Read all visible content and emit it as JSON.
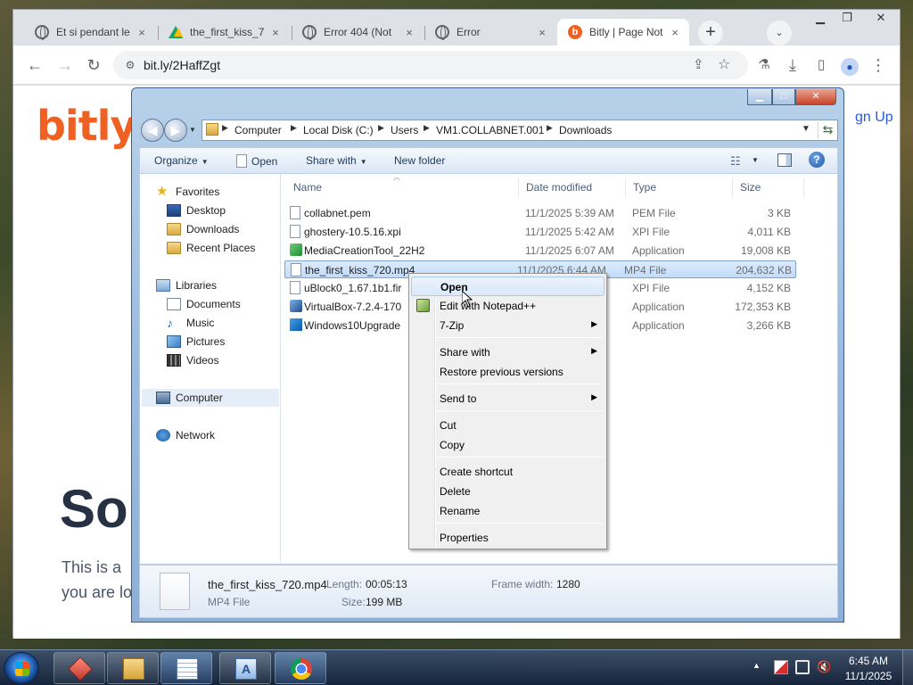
{
  "browser": {
    "tabs": [
      {
        "title": "Et si pendant le",
        "icon": "globe-icon"
      },
      {
        "title": "the_first_kiss_7",
        "icon": "google-drive-icon"
      },
      {
        "title": "Error 404 (Not",
        "icon": "globe-icon"
      },
      {
        "title": "Error",
        "icon": "globe-icon"
      },
      {
        "title": "Bitly | Page Not",
        "icon": "bitly-icon"
      }
    ],
    "active_tab": 4,
    "url": "bit.ly/2HaffZgt",
    "bitly_fav": "b",
    "new_tab": "+",
    "tab_search": "⌄",
    "close_glyph": "×"
  },
  "bitly_page": {
    "logo": "bitly",
    "signup": "gn Up",
    "title_fragment": "Sor",
    "para_line1": "This is a ",
    "para_line2": "you are lo"
  },
  "explorer": {
    "breadcrumb": [
      "Computer",
      "Local Disk (C:)",
      "Users",
      "VM1.COLLABNET.001",
      "Downloads"
    ],
    "toolbar": {
      "organize": "Organize",
      "open": "Open",
      "share_with": "Share with",
      "new_folder": "New folder"
    },
    "nav": {
      "favorites": "Favorites",
      "favorites_items": [
        "Desktop",
        "Downloads",
        "Recent Places"
      ],
      "libraries": "Libraries",
      "libraries_items": [
        "Documents",
        "Music",
        "Pictures",
        "Videos"
      ],
      "computer": "Computer",
      "network": "Network"
    },
    "columns": {
      "name": "Name",
      "date": "Date modified",
      "type": "Type",
      "size": "Size"
    },
    "files": [
      {
        "name": "collabnet.pem",
        "date": "11/1/2025 5:39 AM",
        "type": "PEM File",
        "size": "3 KB",
        "icon": "blank"
      },
      {
        "name": "ghostery-10.5.16.xpi",
        "date": "11/1/2025 5:42 AM",
        "type": "XPI File",
        "size": "4,011 KB",
        "icon": "blank"
      },
      {
        "name": "MediaCreationTool_22H2",
        "date": "11/1/2025 6:07 AM",
        "type": "Application",
        "size": "19,008 KB",
        "icon": "mct"
      },
      {
        "name": "the_first_kiss_720.mp4",
        "date": "11/1/2025 6:44 AM",
        "type": "MP4 File",
        "size": "204,632 KB",
        "icon": "blank"
      },
      {
        "name": "uBlock0_1.67.1b1.fir",
        "date": "",
        "type": "XPI File",
        "size": "4,152 KB",
        "icon": "blank"
      },
      {
        "name": "VirtualBox-7.2.4-170",
        "date": "",
        "type": "Application",
        "size": "172,353 KB",
        "icon": "vb"
      },
      {
        "name": "Windows10Upgrade",
        "date": "",
        "type": "Application",
        "size": "3,266 KB",
        "icon": "win"
      }
    ],
    "selected_file": 3,
    "details": {
      "name": "the_first_kiss_720.mp4",
      "type": "MP4 File",
      "length_label": "Length:",
      "length": "00:05:13",
      "size_label": "Size:",
      "size": "199 MB",
      "frame_label": "Frame width:",
      "frame": "1280"
    }
  },
  "context_menu": {
    "items": [
      {
        "label": "Open",
        "bold": true,
        "hover": true
      },
      {
        "label": "Edit with Notepad++",
        "icon": "notepad-plus-plus-icon"
      },
      {
        "label": "7-Zip",
        "submenu": true
      },
      {
        "label": "Share with",
        "submenu": true
      },
      {
        "label": "Restore previous versions"
      },
      {
        "label": "Send to",
        "submenu": true
      },
      {
        "label": "Cut"
      },
      {
        "label": "Copy"
      },
      {
        "label": "Create shortcut"
      },
      {
        "label": "Delete"
      },
      {
        "label": "Rename"
      },
      {
        "label": "Properties"
      }
    ]
  },
  "taskbar": {
    "clock_time": "6:45 AM",
    "clock_date": "11/1/2025"
  }
}
